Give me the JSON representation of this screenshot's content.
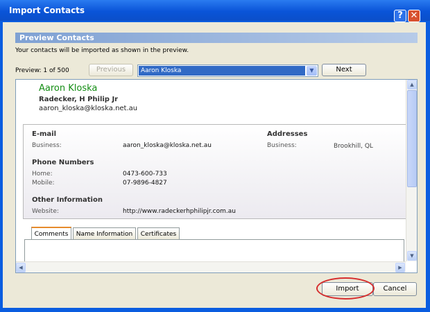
{
  "window": {
    "title": "Import Contacts",
    "help_label": "?",
    "close_label": "✕"
  },
  "preview": {
    "header": "Preview Contacts",
    "description": "Your contacts will be imported as shown in the preview.",
    "count_label": "Preview: 1 of 500",
    "previous_label": "Previous",
    "next_label": "Next",
    "selected_contact": "Aaron Kloska"
  },
  "contact": {
    "name": "Aaron Kloska",
    "company": "Radecker, H Philip Jr",
    "email": "aaron_kloska@kloska.net.au",
    "email_section": {
      "title": "E-mail",
      "business_label": "Business:",
      "business_value": "aaron_kloska@kloska.net.au"
    },
    "addresses_section": {
      "title": "Addresses",
      "business_label": "Business:",
      "business_value": "Brookhill, QL"
    },
    "phone_section": {
      "title": "Phone Numbers",
      "home_label": "Home:",
      "home_value": "0473-600-733",
      "mobile_label": "Mobile:",
      "mobile_value": "07-9896-4827"
    },
    "other_section": {
      "title": "Other Information",
      "website_label": "Website:",
      "website_value": "http://www.radeckerhphilipjr.com.au"
    }
  },
  "tabs": [
    "Comments",
    "Name Information",
    "Certificates"
  ],
  "buttons": {
    "import_label": "Import",
    "cancel_label": "Cancel"
  },
  "colors": {
    "title_bar": "#0a54d8",
    "contact_name": "#138d13",
    "selection": "#316ac5",
    "highlight_circle": "#d62d2d"
  }
}
